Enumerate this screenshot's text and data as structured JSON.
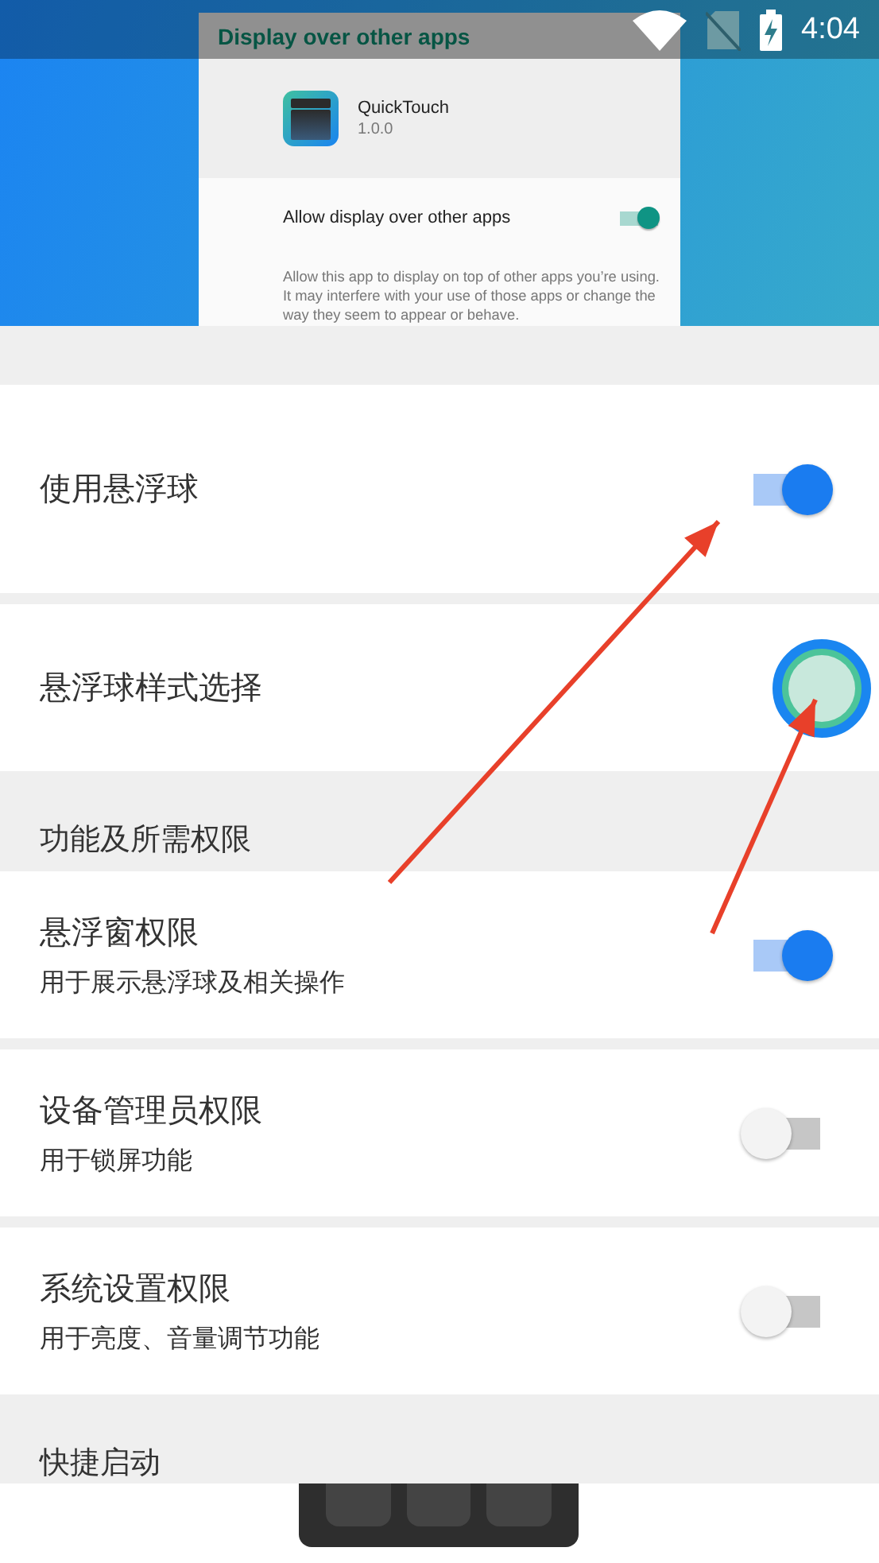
{
  "status_bar": {
    "time": "4:04"
  },
  "embedded_screenshot": {
    "title": "Display over other apps",
    "app_name": "QuickTouch",
    "app_version": "1.0.0",
    "toggle_label": "Allow display over other apps",
    "toggle_on": true,
    "description": "Allow this app to display on top of other apps you’re using. It may interfere with your use of those apps or change the way they seem to appear or behave."
  },
  "settings": [
    {
      "kind": "switch",
      "title": "使用悬浮球",
      "on": true
    },
    {
      "kind": "ball",
      "title": "悬浮球样式选择"
    },
    {
      "kind": "section",
      "title": "功能及所需权限"
    },
    {
      "kind": "switch",
      "title": "悬浮窗权限",
      "subtitle": "用于展示悬浮球及相关操作",
      "on": true
    },
    {
      "kind": "switch",
      "title": "设备管理员权限",
      "subtitle": "用于锁屏功能",
      "on": false
    },
    {
      "kind": "switch",
      "title": "系统设置权限",
      "subtitle": "用于亮度、音量调节功能",
      "on": false
    },
    {
      "kind": "section",
      "title": "快捷启动"
    }
  ]
}
